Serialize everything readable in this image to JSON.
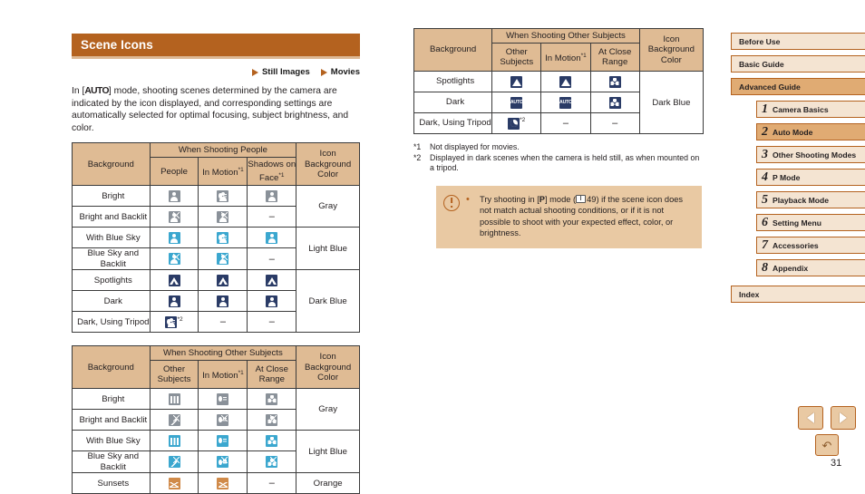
{
  "section": {
    "title": "Scene Icons",
    "media_tags": [
      "Still Images",
      "Movies"
    ],
    "intro_pre": "In [",
    "intro_kbd": "AUTO",
    "intro_post": "] mode, shooting scenes determined by the camera are indicated by the icon displayed, and corresponding settings are automatically selected for optimal focusing, subject brightness, and color."
  },
  "table_people": {
    "group_header": "When Shooting People",
    "col_background": "Background",
    "col_icon_bg": "Icon Background Color",
    "columns": [
      "People",
      "In Motion*1",
      "Shadows on Face*1"
    ],
    "rows": [
      {
        "background": "Bright",
        "cells": [
          "person-gray",
          "person-motion-gray",
          "person-gray"
        ]
      },
      {
        "background": "Bright and Backlit",
        "cells": [
          "person-backlit-gray",
          "person-backlit-gray",
          "dash"
        ]
      },
      {
        "background": "With Blue Sky",
        "cells": [
          "person-lblue",
          "person-motion-lblue",
          "person-lblue"
        ]
      },
      {
        "background": "Blue Sky and Backlit",
        "cells": [
          "person-backlit-lblue",
          "person-backlit-lblue",
          "dash"
        ]
      },
      {
        "background": "Spotlights",
        "cells": [
          "spotlight-dblue",
          "spotlight-dblue",
          "spotlight-dblue"
        ]
      },
      {
        "background": "Dark",
        "cells": [
          "person-dblue",
          "person-dblue",
          "person-dblue"
        ]
      },
      {
        "background": "Dark, Using Tripod",
        "cells": [
          "person-tripod-dblue",
          "dash",
          "dash"
        ]
      }
    ],
    "icon_bg_groups": [
      {
        "label": "Gray",
        "span": 2
      },
      {
        "label": "Light Blue",
        "span": 2
      },
      {
        "label": "Dark Blue",
        "span": 3
      }
    ]
  },
  "table_other_left": {
    "group_header": "When Shooting Other Subjects",
    "col_background": "Background",
    "col_icon_bg": "Icon Background Color",
    "columns": [
      "Other Subjects",
      "In Motion*1",
      "At Close Range"
    ],
    "rows": [
      {
        "background": "Bright",
        "cells": [
          "scene-gray",
          "card-gray",
          "macro-gray"
        ]
      },
      {
        "background": "Bright and Backlit",
        "cells": [
          "scene-backlit-gray",
          "card-backlit-gray",
          "macro-backlit-gray"
        ]
      },
      {
        "background": "With Blue Sky",
        "cells": [
          "scene-lblue",
          "card-lblue",
          "macro-lblue"
        ]
      },
      {
        "background": "Blue Sky and Backlit",
        "cells": [
          "scene-backlit-lblue",
          "card-backlit-lblue",
          "macro-backlit-lblue"
        ]
      },
      {
        "background": "Sunsets",
        "cells": [
          "sunset-orange",
          "sunset-orange",
          "dash"
        ]
      }
    ],
    "icon_bg_groups": [
      {
        "label": "Gray",
        "span": 2
      },
      {
        "label": "Light Blue",
        "span": 2
      },
      {
        "label": "Orange",
        "span": 1
      }
    ]
  },
  "table_other_right": {
    "group_header": "When Shooting Other Subjects",
    "col_background": "Background",
    "col_icon_bg": "Icon Background Color",
    "columns": [
      "Other Subjects",
      "In Motion*1",
      "At Close Range"
    ],
    "rows": [
      {
        "background": "Spotlights",
        "cells": [
          "spotlight-plain-dblue",
          "spotlight-plain-dblue",
          "macro-dblue"
        ]
      },
      {
        "background": "Dark",
        "cells": [
          "auto-dblue",
          "auto-dblue",
          "macro-dblue"
        ]
      },
      {
        "background": "Dark, Using Tripod",
        "cells": [
          "moon-dblue",
          "dash",
          "dash"
        ]
      }
    ],
    "icon_bg_groups": [
      {
        "label": "Dark Blue",
        "span": 3
      }
    ]
  },
  "footnotes": [
    {
      "mark": "*1",
      "text": "Not displayed for movies."
    },
    {
      "mark": "*2",
      "text": "Displayed in dark scenes when the camera is held still, as when mounted on a tripod."
    }
  ],
  "tip": {
    "text_part1": "Try shooting in [",
    "mode_letter": "P",
    "text_part2": "] mode (",
    "page_ref": "49",
    "text_part3": ") if the scene icon does not match actual shooting conditions, or if it is not possible to shoot with your expected effect, color, or brightness."
  },
  "sidebar": {
    "top_items": [
      {
        "label": "Before Use",
        "active": false
      },
      {
        "label": "Basic Guide",
        "active": false
      },
      {
        "label": "Advanced Guide",
        "active": true
      }
    ],
    "chapters": [
      {
        "num": "1",
        "label": "Camera Basics",
        "active": false
      },
      {
        "num": "2",
        "label": "Auto Mode",
        "active": true
      },
      {
        "num": "3",
        "label": "Other Shooting Modes",
        "active": false
      },
      {
        "num": "4",
        "label": "P Mode",
        "active": false
      },
      {
        "num": "5",
        "label": "Playback Mode",
        "active": false
      },
      {
        "num": "6",
        "label": "Setting Menu",
        "active": false
      },
      {
        "num": "7",
        "label": "Accessories",
        "active": false
      },
      {
        "num": "8",
        "label": "Appendix",
        "active": false
      }
    ],
    "index_label": "Index"
  },
  "pager": {
    "prev_label": "previous-page",
    "next_label": "next-page",
    "home_label": "home",
    "page_number": "31"
  },
  "colors": {
    "accent": "#b4621f",
    "header_fill": "#dfbb94",
    "active_nav": "#e0ab73",
    "nav_fill": "#f4e4d2",
    "tip_fill": "#e9c9a3",
    "icon_gray": "#8a9199",
    "icon_light_blue": "#3ba7cf",
    "icon_dark_blue": "#2a3b66",
    "icon_orange": "#d08a49"
  }
}
